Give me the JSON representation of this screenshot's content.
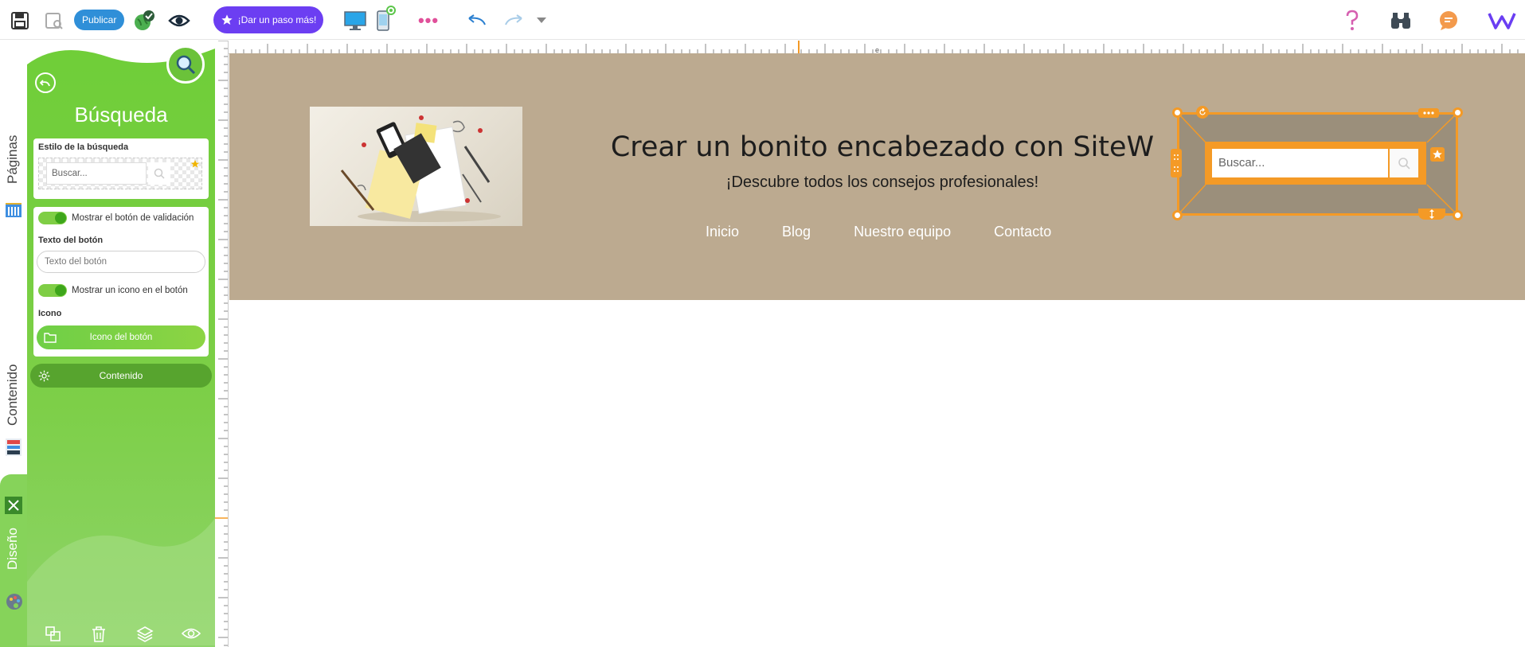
{
  "toolbar": {
    "publish_label": "Publicar",
    "promo_label": "¡Dar un paso más!",
    "dots_label": "•••"
  },
  "left_tabs": {
    "pages": "Páginas",
    "content": "Contenido",
    "design": "Diseño"
  },
  "panel": {
    "title": "Búsqueda",
    "style_section_label": "Estilo de la búsqueda",
    "style_preview_placeholder": "Buscar...",
    "show_validation_label": "Mostrar el botón de validación",
    "button_text_label": "Texto del botón",
    "button_text_placeholder": "Texto del botón",
    "show_icon_label": "Mostrar un icono en el botón",
    "icon_label": "Icono",
    "icon_button_label": "Icono del botón",
    "content_label": "Contenido"
  },
  "ruler": {
    "marker": "e"
  },
  "header": {
    "headline": "Crear un bonito encabezado con SiteW",
    "subline": "¡Descubre todos los consejos profesionales!",
    "nav": [
      "Inicio",
      "Blog",
      "Nuestro equipo",
      "Contacto"
    ],
    "search_placeholder": "Buscar..."
  },
  "colors": {
    "accent_green": "#6fce38",
    "selection_orange": "#f49a26",
    "header_bg": "#bcaa90",
    "promo_purple": "#6c3ef2",
    "publish_blue": "#2f8fd8"
  }
}
